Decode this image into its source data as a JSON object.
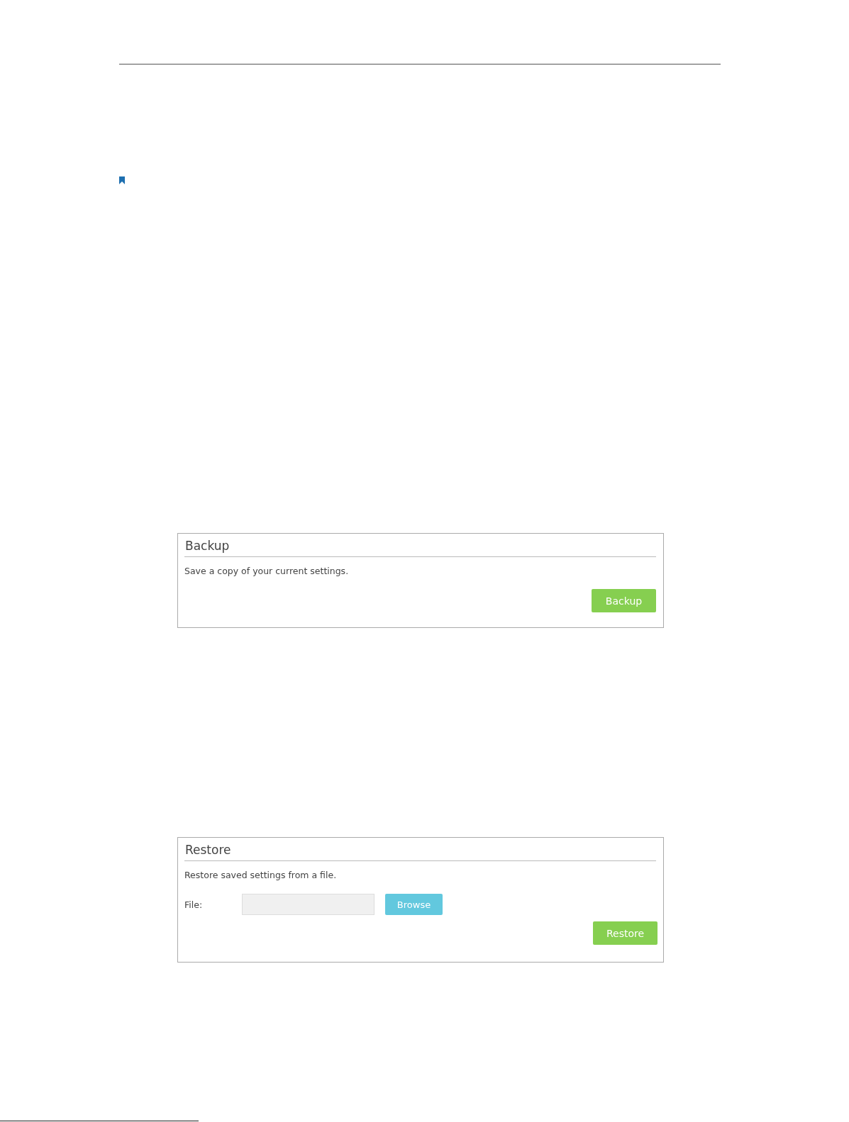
{
  "backup_panel": {
    "title": "Backup",
    "description": "Save a copy of your current settings.",
    "button": "Backup"
  },
  "restore_panel": {
    "title": "Restore",
    "description": "Restore saved settings from a file.",
    "file_label": "File:",
    "browse_button": "Browse",
    "button": "Restore"
  }
}
